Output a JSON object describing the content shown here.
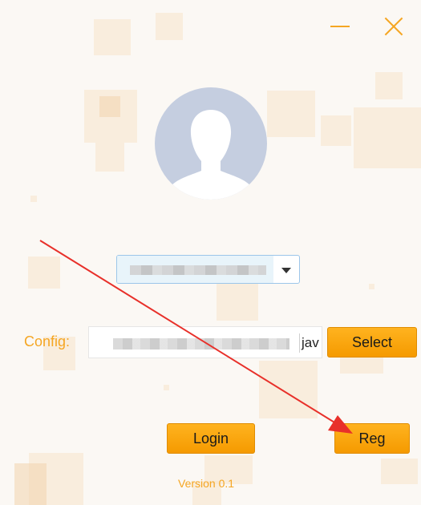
{
  "window": {
    "minimize_icon": "minimize-icon",
    "close_icon": "close-icon"
  },
  "avatar": {
    "icon": "user-silhouette-icon"
  },
  "account_dropdown": {
    "selected_value": "",
    "icon": "chevron-down-icon"
  },
  "config": {
    "label": "Config:",
    "input_value_tail": "jav",
    "select_label": "Select"
  },
  "actions": {
    "login_label": "Login",
    "reg_label": "Reg"
  },
  "footer": {
    "version": "Version 0.1"
  },
  "colors": {
    "accent": "#f5a623",
    "button": "#ffaa10",
    "avatar_bg": "#c5cee0",
    "annotation_arrow": "#e8302a"
  }
}
